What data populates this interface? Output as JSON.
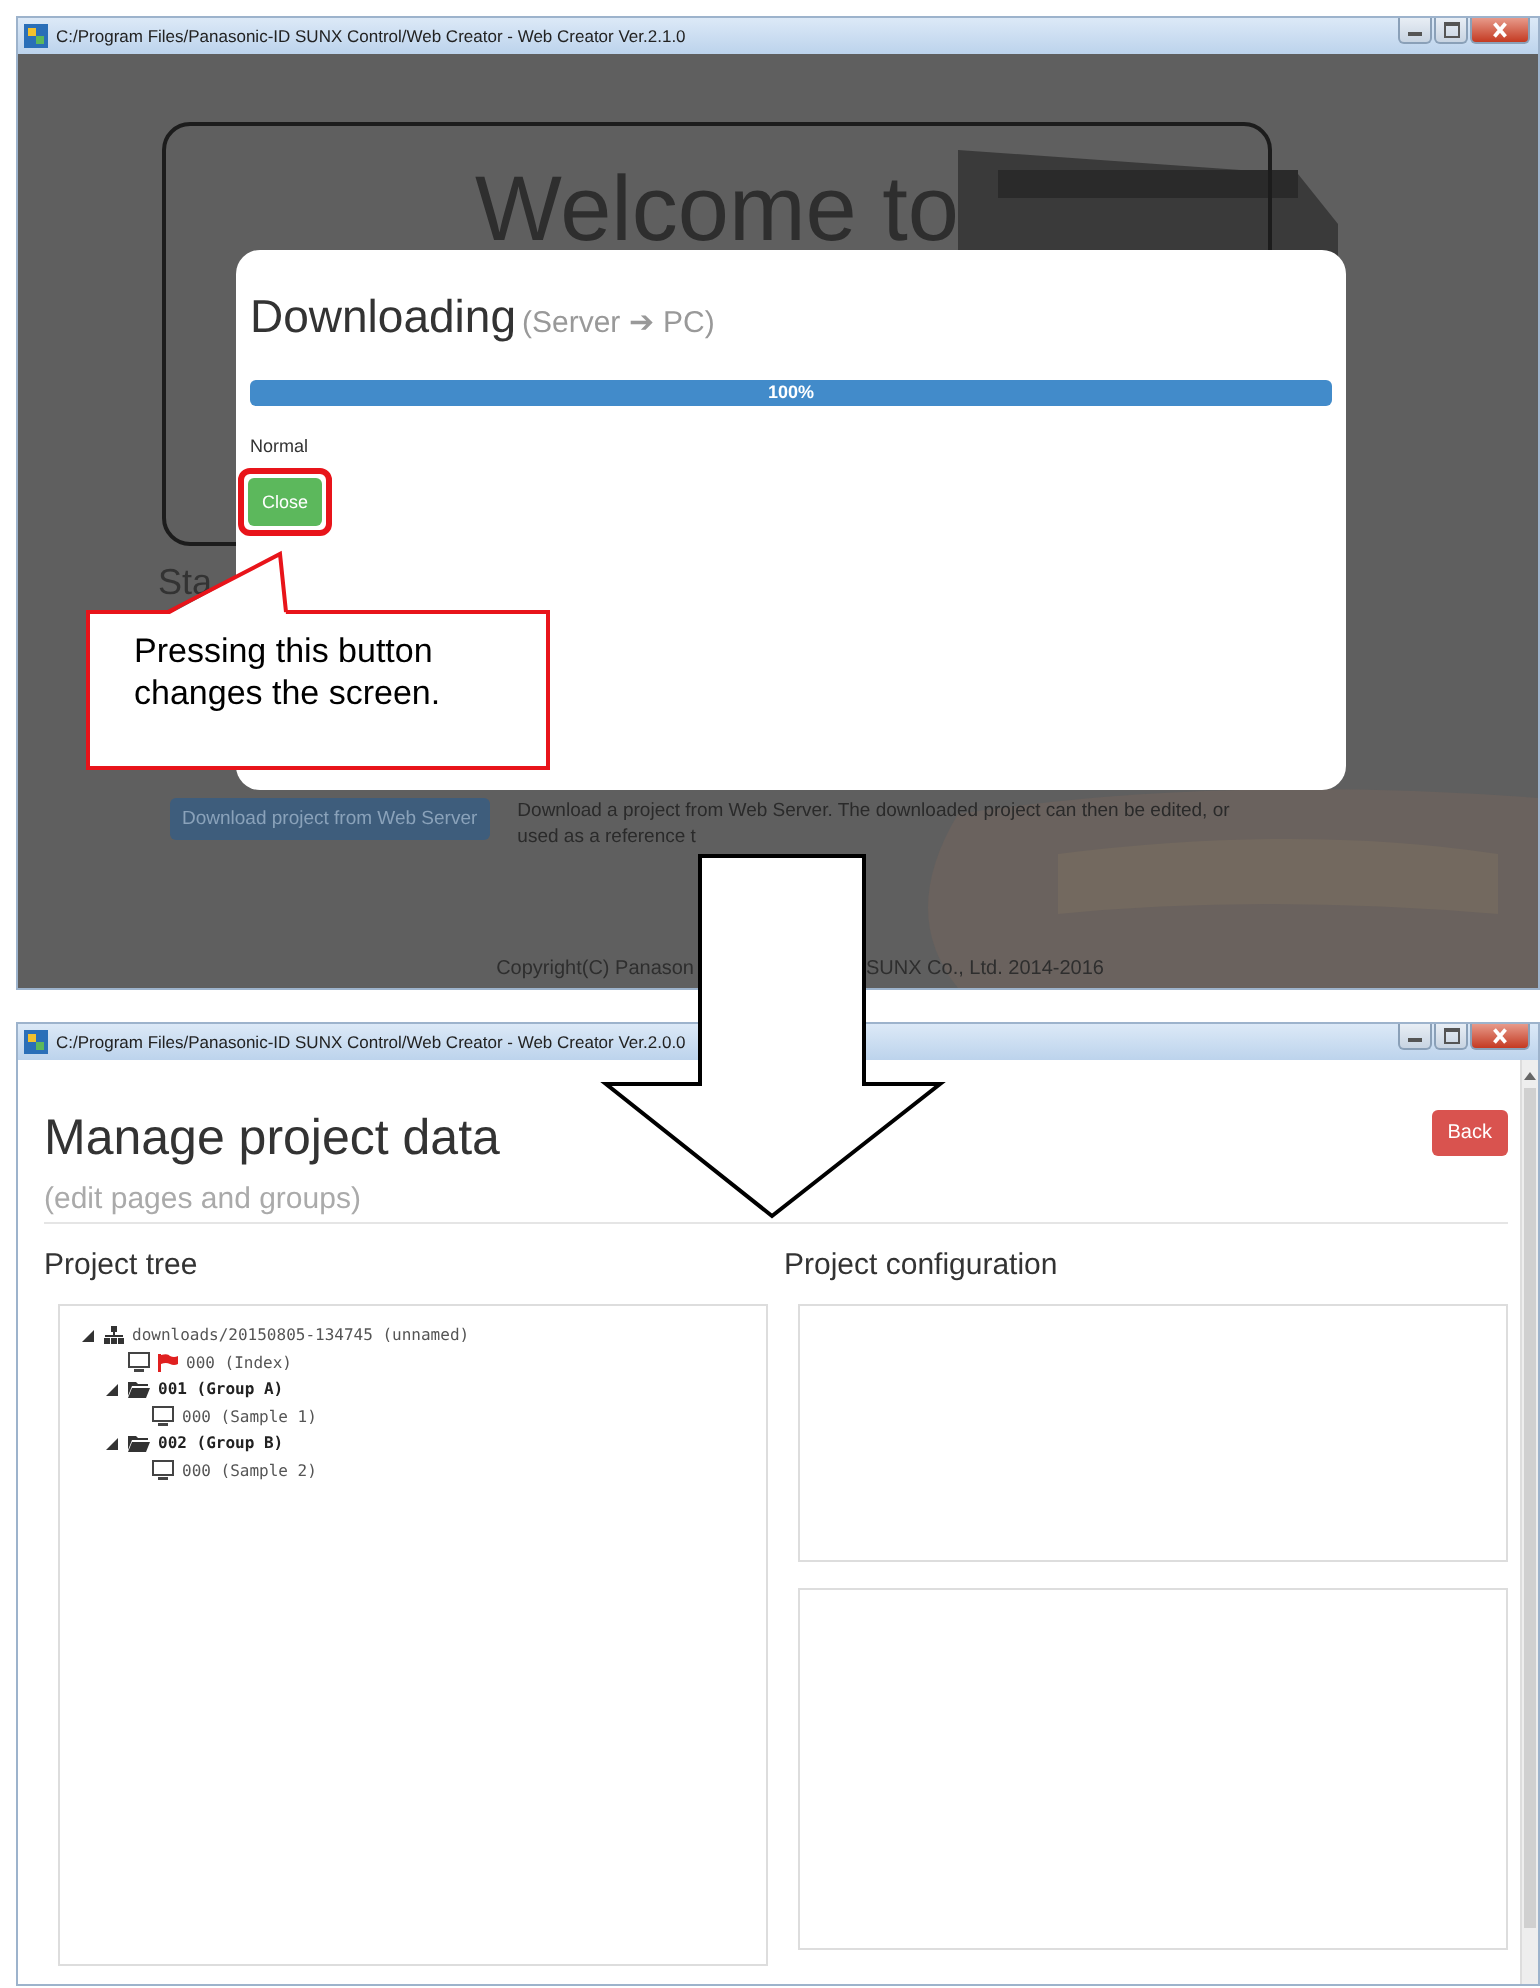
{
  "top_window": {
    "title": "C:/Program Files/Panasonic-ID SUNX Control/Web Creator - Web Creator Ver.2.1.0",
    "background": {
      "welcome_heading": "Welcome to",
      "section_heading": "Sta",
      "download_button": "Download project from Web Server",
      "description_lines": [
        "Download a project from Web Server. The downloaded project can then be edited, or",
        "used as a reference t"
      ],
      "copyright_parts": [
        "Copyright(C) Panason",
        "SUNX Co., Ltd. 2014-2016"
      ]
    },
    "dialog": {
      "title": "Downloading",
      "subtitle": "(Server ➔ PC)",
      "progress": {
        "level": 1,
        "label": "100%"
      },
      "status": "Normal",
      "close_button": "Close",
      "close_highlighted": true
    }
  },
  "callout": {
    "text": "Pressing this button changes the screen."
  },
  "bottom_window": {
    "title": "C:/Program Files/Panasonic-ID SUNX Control/Web Creator - Web Creator Ver.2.0.0",
    "heading": "Manage project data",
    "subheading": "(edit pages and groups)",
    "back_button": "Back",
    "tree_title": "Project tree",
    "config_title": "Project configuration",
    "tree": {
      "label": "downloads/20150805-134745 (unnamed)",
      "kind": "project",
      "expanded": true,
      "children": [
        {
          "label": "000 (Index)",
          "kind": "page",
          "flagged": true
        },
        {
          "label": "001 (Group A)",
          "kind": "group",
          "expanded": true,
          "children": [
            {
              "label": "000 (Sample 1)",
              "kind": "page",
              "flagged": false
            }
          ]
        },
        {
          "label": "002 (Group B)",
          "kind": "group",
          "expanded": true,
          "children": [
            {
              "label": "000 (Sample 2)",
              "kind": "page",
              "flagged": false
            }
          ]
        }
      ]
    }
  }
}
